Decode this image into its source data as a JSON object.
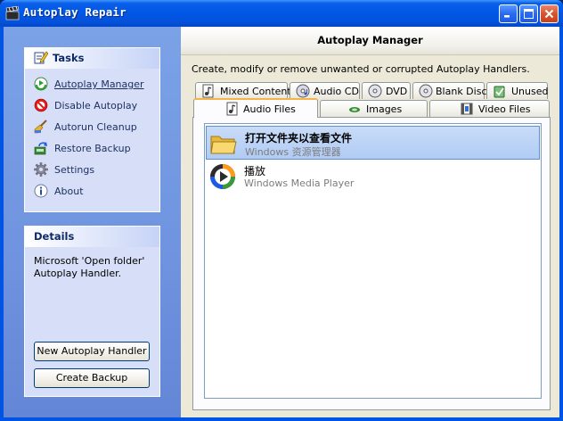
{
  "window": {
    "title": "Autoplay Repair",
    "title_icon": "clapperboard-icon"
  },
  "titlebar_buttons": [
    {
      "name": "minimize-button",
      "icon": "minimize-icon"
    },
    {
      "name": "maximize-button",
      "icon": "maximize-icon"
    },
    {
      "name": "close-button",
      "icon": "close-icon"
    }
  ],
  "sidebar": {
    "tasks": {
      "title": "Tasks",
      "header_icon": "tasks-pencil-icon",
      "items": [
        {
          "label": "Autoplay Manager",
          "icon": "autoplay-manager-icon",
          "active": true
        },
        {
          "label": "Disable Autoplay",
          "icon": "no-entry-icon"
        },
        {
          "label": "Autorun Cleanup",
          "icon": "broom-icon"
        },
        {
          "label": "Restore Backup",
          "icon": "restore-backup-icon"
        },
        {
          "label": "Settings",
          "icon": "gear-icon"
        },
        {
          "label": "About",
          "icon": "info-icon"
        }
      ]
    },
    "details": {
      "title": "Details",
      "text_line1": "Microsoft 'Open folder'",
      "text_line2": "Autoplay Handler."
    },
    "buttons": {
      "new_handler": "New Autoplay Handler",
      "create_backup": "Create Backup"
    }
  },
  "main": {
    "header": "Autoplay Manager",
    "description": "Create, modify or remove unwanted or corrupted Autoplay Handlers.",
    "tabs_row1": [
      {
        "label": "Mixed Content",
        "icon": "mixed-content-icon"
      },
      {
        "label": "Audio CD",
        "icon": "audio-cd-icon"
      },
      {
        "label": "DVD",
        "icon": "dvd-icon"
      },
      {
        "label": "Blank Disc",
        "icon": "blank-disc-icon"
      },
      {
        "label": "Unused",
        "icon": "unused-icon"
      }
    ],
    "tabs_row2": [
      {
        "label": "Audio Files",
        "icon": "audio-file-icon",
        "active": true
      },
      {
        "label": "Images",
        "icon": "images-icon"
      },
      {
        "label": "Video Files",
        "icon": "video-file-icon"
      }
    ],
    "handlers": [
      {
        "title": "打开文件夹以查看文件",
        "subtitle": "Windows 资源管理器",
        "icon": "folder-icon",
        "selected": true
      },
      {
        "title": "播放",
        "subtitle": "Windows Media Player",
        "icon": "media-player-icon",
        "selected": false
      }
    ]
  },
  "colors": {
    "titlebar_blue": "#0058e6",
    "close_red": "#d9532e",
    "sidebar_blue": "#7ba2e7",
    "selection": "#b0cbf4",
    "active_tab_accent": "#f8b24a"
  }
}
